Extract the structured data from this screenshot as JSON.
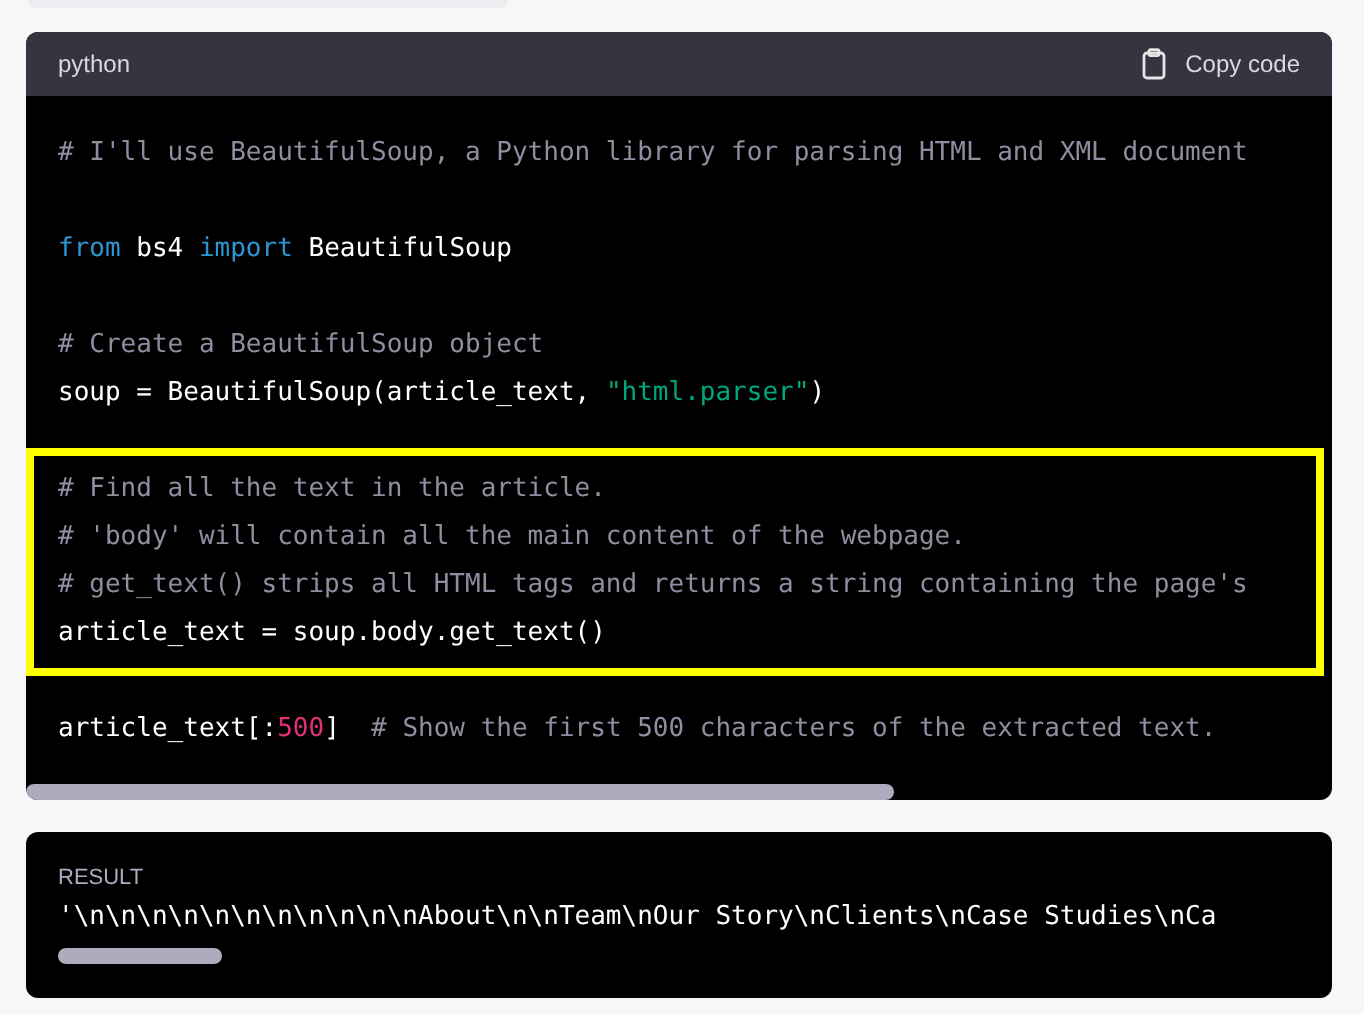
{
  "code_block": {
    "language": "python",
    "copy_button": "Copy code",
    "groups": [
      {
        "highlighted": false,
        "lines": [
          [
            {
              "text": "# I'll use BeautifulSoup, a Python library for parsing HTML and XML document",
              "kind": "comment"
            }
          ]
        ]
      },
      {
        "highlighted": false,
        "lines": [
          [
            {
              "text": "from",
              "kind": "keyword"
            },
            {
              "text": " bs4 ",
              "kind": "plain"
            },
            {
              "text": "import",
              "kind": "keyword"
            },
            {
              "text": " BeautifulSoup",
              "kind": "plain"
            }
          ]
        ]
      },
      {
        "highlighted": false,
        "lines": [
          [
            {
              "text": "# Create a BeautifulSoup object",
              "kind": "comment"
            }
          ],
          [
            {
              "text": "soup = BeautifulSoup(article_text, ",
              "kind": "plain"
            },
            {
              "text": "\"html.parser\"",
              "kind": "string"
            },
            {
              "text": ")",
              "kind": "plain"
            }
          ]
        ]
      },
      {
        "highlighted": true,
        "lines": [
          [
            {
              "text": "# Find all the text in the article.",
              "kind": "comment"
            }
          ],
          [
            {
              "text": "# 'body' will contain all the main content of the webpage.",
              "kind": "comment"
            }
          ],
          [
            {
              "text": "# get_text() strips all HTML tags and returns a string containing the page's",
              "kind": "comment"
            }
          ],
          [
            {
              "text": "article_text = soup.body.get_text()",
              "kind": "plain"
            }
          ]
        ]
      },
      {
        "highlighted": false,
        "lines": [
          [
            {
              "text": "article_text[:",
              "kind": "plain"
            },
            {
              "text": "500",
              "kind": "number"
            },
            {
              "text": "]  ",
              "kind": "plain"
            },
            {
              "text": "# Show the first 500 characters of the extracted text.",
              "kind": "comment"
            }
          ]
        ]
      }
    ]
  },
  "result": {
    "label": "RESULT",
    "output": "'\\n\\n\\n\\n\\n\\n\\n\\n\\n\\n\\nAbout\\n\\nTeam\\nOur Story\\nClients\\nCase Studies\\nCa"
  }
}
